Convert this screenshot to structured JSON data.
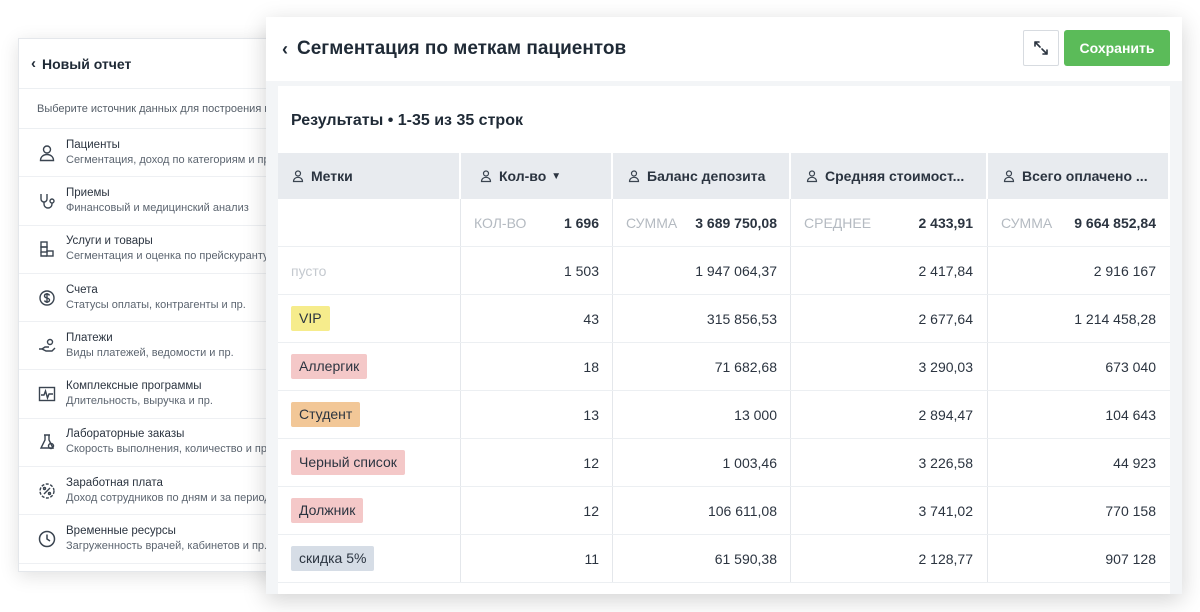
{
  "back_panel": {
    "title": "Новый отчет",
    "hint": "Выберите источник данных для построения н",
    "items": [
      {
        "icon": "person-icon",
        "title": "Пациенты",
        "subtitle": "Сегментация, доход по категориям и пр."
      },
      {
        "icon": "stethoscope-icon",
        "title": "Приемы",
        "subtitle": "Финансовый и медицинский анализ"
      },
      {
        "icon": "boxes-icon",
        "title": "Услуги и товары",
        "subtitle": "Сегментация и оценка по прейскуранту"
      },
      {
        "icon": "invoice-icon",
        "title": "Счета",
        "subtitle": "Статусы оплаты, контрагенты и пр."
      },
      {
        "icon": "payment-hand-icon",
        "title": "Платежи",
        "subtitle": "Виды платежей, ведомости и пр."
      },
      {
        "icon": "pulse-chart-icon",
        "title": "Комплексные программы",
        "subtitle": "Длительность, выручка и пр."
      },
      {
        "icon": "flask-icon",
        "title": "Лабораторные заказы",
        "subtitle": "Скорость выполнения, количество и пр."
      },
      {
        "icon": "percent-badge-icon",
        "title": "Заработная плата",
        "subtitle": "Доход сотрудников по дням и за период"
      },
      {
        "icon": "clock-icon",
        "title": "Временные ресурсы",
        "subtitle": "Загруженность врачей, кабинетов и пр."
      }
    ]
  },
  "report": {
    "title": "Сегментация по меткам пациентов",
    "save_label": "Сохранить",
    "results_label": "Результаты • 1-35 из 35 строк",
    "columns": [
      {
        "label": "Метки"
      },
      {
        "label": "Кол-во",
        "sorted": true
      },
      {
        "label": "Баланс депозита"
      },
      {
        "label": "Средняя стоимост..."
      },
      {
        "label": "Всего оплачено ..."
      }
    ],
    "aggregates": [
      {
        "label": "",
        "value": ""
      },
      {
        "label": "КОЛ-ВО",
        "value": "1 696"
      },
      {
        "label": "СУММА",
        "value": "3 689 750,08"
      },
      {
        "label": "СРЕДНЕЕ",
        "value": "2 433,91"
      },
      {
        "label": "СУММА",
        "value": "9 664 852,84"
      }
    ],
    "rows": [
      {
        "tag": "пусто",
        "tag_color": "",
        "count": "1 503",
        "balance": "1 947 064,37",
        "avg": "2 417,84",
        "paid": "2 916 167"
      },
      {
        "tag": "VIP",
        "tag_color": "#f6ec8c",
        "count": "43",
        "balance": "315 856,53",
        "avg": "2 677,64",
        "paid": "1 214 458,28"
      },
      {
        "tag": "Аллергик",
        "tag_color": "#f4c8c8",
        "count": "18",
        "balance": "71 682,68",
        "avg": "3 290,03",
        "paid": "673 040"
      },
      {
        "tag": "Студент",
        "tag_color": "#f2c797",
        "count": "13",
        "balance": "13 000",
        "avg": "2 894,47",
        "paid": "104 643"
      },
      {
        "tag": "Черный список",
        "tag_color": "#f4c8c8",
        "count": "12",
        "balance": "1 003,46",
        "avg": "3 226,58",
        "paid": "44 923"
      },
      {
        "tag": "Должник",
        "tag_color": "#f4c8c8",
        "count": "12",
        "balance": "106 611,08",
        "avg": "3 741,02",
        "paid": "770 158"
      },
      {
        "tag": "скидка 5%",
        "tag_color": "#d6dde6",
        "count": "11",
        "balance": "61 590,38",
        "avg": "2 128,77",
        "paid": "907 128"
      }
    ]
  }
}
